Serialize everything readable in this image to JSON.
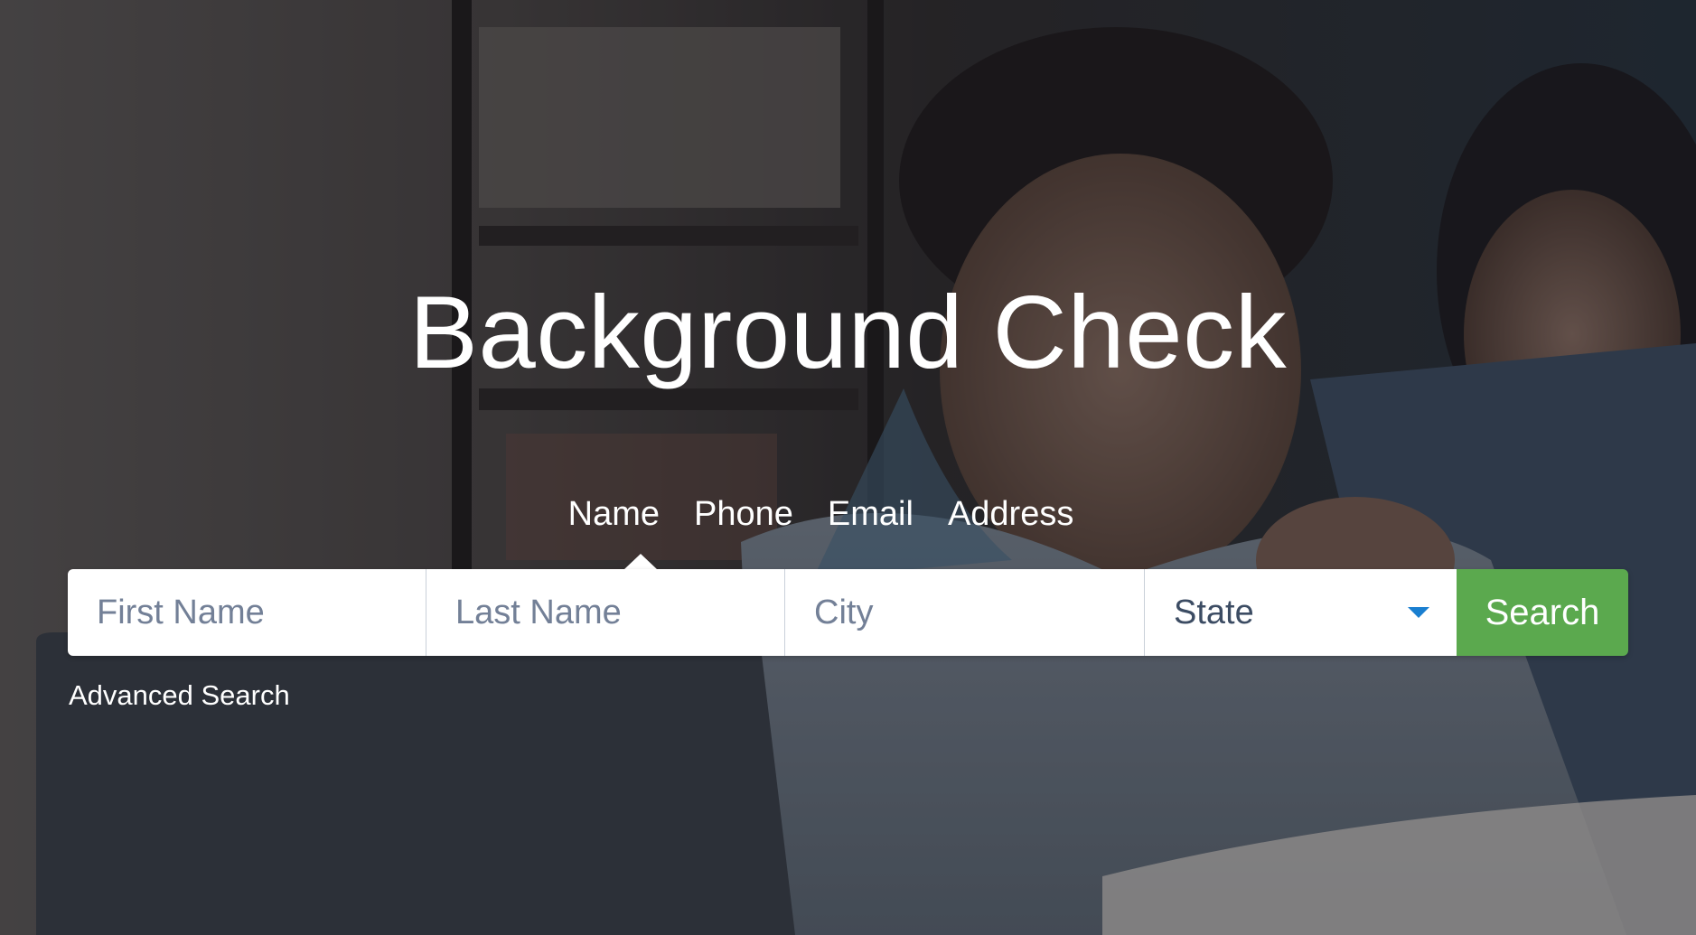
{
  "hero": {
    "title": "Background Check"
  },
  "tabs": [
    {
      "label": "Name",
      "active": true
    },
    {
      "label": "Phone",
      "active": false
    },
    {
      "label": "Email",
      "active": false
    },
    {
      "label": "Address",
      "active": false
    }
  ],
  "search": {
    "first_name_placeholder": "First Name",
    "last_name_placeholder": "Last Name",
    "city_placeholder": "City",
    "state_selected": "State",
    "button_label": "Search"
  },
  "links": {
    "advanced_search": "Advanced Search"
  },
  "colors": {
    "search_button": "#5ba94e",
    "dropdown_arrow": "#1a7fd0",
    "placeholder_text": "#738097"
  },
  "icons": {
    "state_dropdown": "chevron-down-icon",
    "active_tab_pointer": "caret-up-icon"
  }
}
